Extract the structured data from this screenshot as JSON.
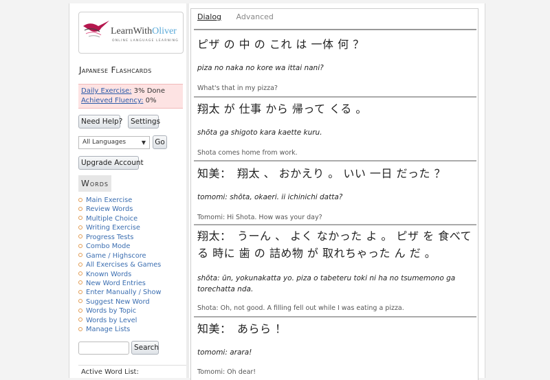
{
  "logo": {
    "name_part1": "LearnWith",
    "name_part2": "Oliver",
    "tagline": "ONLINE LANGUAGE LEARNING"
  },
  "sidebar": {
    "section_title": "Japanese Flashcards",
    "progress": {
      "daily_label": "Daily Exercise:",
      "daily_value": " 3% Done",
      "fluency_label": "Achieved Fluency:",
      "fluency_value": " 0%"
    },
    "help_button": "Need Help?",
    "settings_button": "Settings",
    "language_select": "All Languages",
    "go_button": "Go",
    "upgrade_button": "Upgrade Account",
    "words_heading": "Words",
    "menu": [
      "Main Exercise",
      "Review Words",
      "Multiple Choice",
      "Writing Exercise",
      "Progress Tests",
      "Combo Mode",
      "Game / Highscore",
      "All Exercises & Games",
      "Known Words",
      "New Word Entries",
      "Enter Manually / Show",
      "Suggest New Word",
      "Words by Topic",
      "Words by Level",
      "Manage Lists"
    ],
    "search_button": "Search",
    "active_list_label": "Active Word List:"
  },
  "content": {
    "tabs": [
      "Dialog",
      "Advanced"
    ],
    "entries": [
      {
        "jp": "ピザ の 中 の これ は 一体 何 ？",
        "romaji": "piza no naka no kore wa ittai nani?",
        "en": "What's that in my pizza?"
      },
      {
        "jp": "翔太 が 仕事 から 帰って くる 。",
        "romaji": "shōta ga shigoto kara kaette kuru.",
        "en": "Shota comes home from work."
      },
      {
        "jp": "知美：　翔太 、 おかえり 。 いい 一日 だった ？",
        "romaji": "tomomi: shōta, okaeri. ii ichinichi datta?",
        "en": "Tomomi: Hi Shota. How was your day?"
      },
      {
        "jp": "翔太：　うーん 、 よく なかった よ 。 ピザ を 食べてる 時に 歯 の 詰め物 が 取れちゃった ん だ 。",
        "romaji": "shōta: ūn, yokunakatta yo. piza o tabeteru toki ni ha no tsumemono ga torechatta nda.",
        "en": "Shota: Oh, not good. A filling fell out while I was eating a pizza."
      },
      {
        "jp": "知美：　あらら ！",
        "romaji": "tomomi: arara!",
        "en": "Tomomi: Oh dear!"
      }
    ]
  }
}
